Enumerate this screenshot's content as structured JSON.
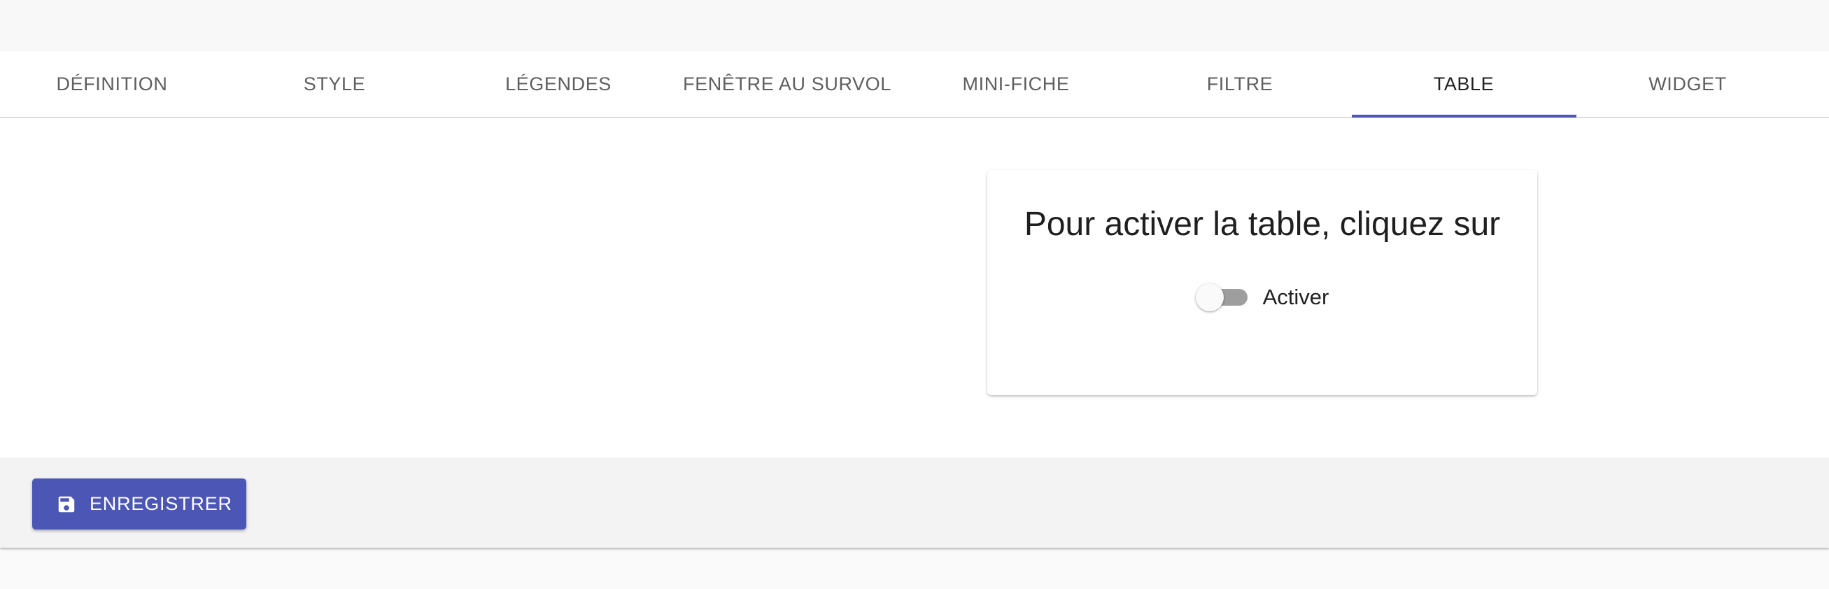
{
  "tabs": [
    {
      "label": "DÉFINITION"
    },
    {
      "label": "STYLE"
    },
    {
      "label": "LÉGENDES"
    },
    {
      "label": "FENÊTRE AU SURVOL"
    },
    {
      "label": "MINI-FICHE"
    },
    {
      "label": "FILTRE"
    },
    {
      "label": "TABLE",
      "active": true
    },
    {
      "label": "WIDGET"
    }
  ],
  "card": {
    "title": "Pour activer la table, cliquez sur",
    "toggle": {
      "label": "Activer",
      "checked": false
    }
  },
  "footer": {
    "save_label": "ENREGISTRER",
    "save_icon": "save-icon"
  },
  "colors": {
    "accent": "#4c56b5",
    "tab_text": "#5f5f5f",
    "footer_bg": "#f3f3f3",
    "switch_off": "#9e9e9e"
  }
}
